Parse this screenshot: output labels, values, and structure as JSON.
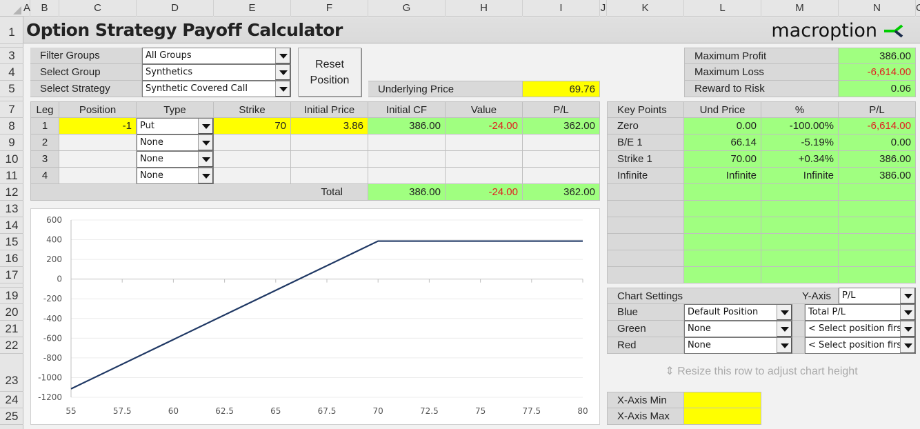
{
  "sheet": {
    "columns": [
      "A",
      "B",
      "C",
      "D",
      "E",
      "F",
      "G",
      "H",
      "I",
      "J",
      "K",
      "L",
      "M",
      "N",
      "O"
    ],
    "rows": [
      "1",
      "3",
      "4",
      "5",
      "7",
      "8",
      "9",
      "10",
      "11",
      "12",
      "13",
      "14",
      "15",
      "16",
      "17",
      "19",
      "20",
      "21",
      "22",
      "23",
      "24",
      "25"
    ]
  },
  "header": {
    "title": "Option Strategy Payoff Calculator",
    "logo_text": "macroption",
    "logo_colors": {
      "green": "#00cc00",
      "navy": "#1a2a4a"
    }
  },
  "selectors": {
    "filter_groups": {
      "label": "Filter Groups",
      "value": "All Groups"
    },
    "select_group": {
      "label": "Select Group",
      "value": "Synthetics"
    },
    "select_strategy": {
      "label": "Select Strategy",
      "value": "Synthetic Covered Call"
    },
    "reset_button": "Reset Position",
    "underlying_price": {
      "label": "Underlying Price",
      "value": "69.76"
    }
  },
  "summary": {
    "max_profit": {
      "label": "Maximum Profit",
      "value": "386.00"
    },
    "max_loss": {
      "label": "Maximum Loss",
      "value": "-6,614.00"
    },
    "reward_risk": {
      "label": "Reward to Risk",
      "value": "0.06"
    }
  },
  "legs": {
    "headers": [
      "Leg",
      "Position",
      "Type",
      "Strike",
      "Initial Price",
      "Initial CF",
      "Value",
      "P/L"
    ],
    "rows": [
      {
        "leg": "1",
        "position": "-1",
        "type": "Put",
        "strike": "70",
        "initial_price": "3.86",
        "initial_cf": "386.00",
        "value": "-24.00",
        "pl": "362.00"
      },
      {
        "leg": "2",
        "position": "",
        "type": "None",
        "strike": "",
        "initial_price": "",
        "initial_cf": "",
        "value": "",
        "pl": ""
      },
      {
        "leg": "3",
        "position": "",
        "type": "None",
        "strike": "",
        "initial_price": "",
        "initial_cf": "",
        "value": "",
        "pl": ""
      },
      {
        "leg": "4",
        "position": "",
        "type": "None",
        "strike": "",
        "initial_price": "",
        "initial_cf": "",
        "value": "",
        "pl": ""
      }
    ],
    "total": {
      "label": "Total",
      "initial_cf": "386.00",
      "value": "-24.00",
      "pl": "362.00"
    }
  },
  "key_points": {
    "headers": [
      "Key Points",
      "Und Price",
      "%",
      "P/L"
    ],
    "rows": [
      {
        "name": "Zero",
        "price": "0.00",
        "pct": "-100.00%",
        "pl": "-6,614.00"
      },
      {
        "name": "B/E 1",
        "price": "66.14",
        "pct": "-5.19%",
        "pl": "0.00"
      },
      {
        "name": "Strike 1",
        "price": "70.00",
        "pct": "+0.34%",
        "pl": "386.00"
      },
      {
        "name": "Infinite",
        "price": "Infinite",
        "pct": "Infinite",
        "pl": "386.00"
      }
    ]
  },
  "chart_settings": {
    "label": "Chart Settings",
    "y_axis_label": "Y-Axis",
    "y_axis_value": "P/L",
    "rows": [
      {
        "label": "Blue",
        "position": "Default Position",
        "series": "Total P/L"
      },
      {
        "label": "Green",
        "position": "None",
        "series": "< Select position first"
      },
      {
        "label": "Red",
        "position": "None",
        "series": "< Select position first"
      }
    ],
    "resize_note": "Resize this row to adjust chart height",
    "x_axis_min_label": "X-Axis Min",
    "x_axis_min": "",
    "x_axis_max_label": "X-Axis Max",
    "x_axis_max": ""
  },
  "chart_data": {
    "type": "line",
    "title": "",
    "xlabel": "",
    "ylabel": "",
    "xlim": [
      55,
      80
    ],
    "ylim": [
      -1200,
      600
    ],
    "x_ticks": [
      "55",
      "57.5",
      "60",
      "62.5",
      "65",
      "67.5",
      "70",
      "72.5",
      "75",
      "77.5",
      "80"
    ],
    "y_ticks": [
      "600",
      "400",
      "200",
      "0",
      "-200",
      "-400",
      "-600",
      "-800",
      "-1000",
      "-1200"
    ],
    "grid": true,
    "series": [
      {
        "name": "Total P/L",
        "color": "#1f3864",
        "x": [
          55,
          66.14,
          70,
          80
        ],
        "y": [
          -1114,
          0,
          386,
          386
        ]
      }
    ]
  }
}
